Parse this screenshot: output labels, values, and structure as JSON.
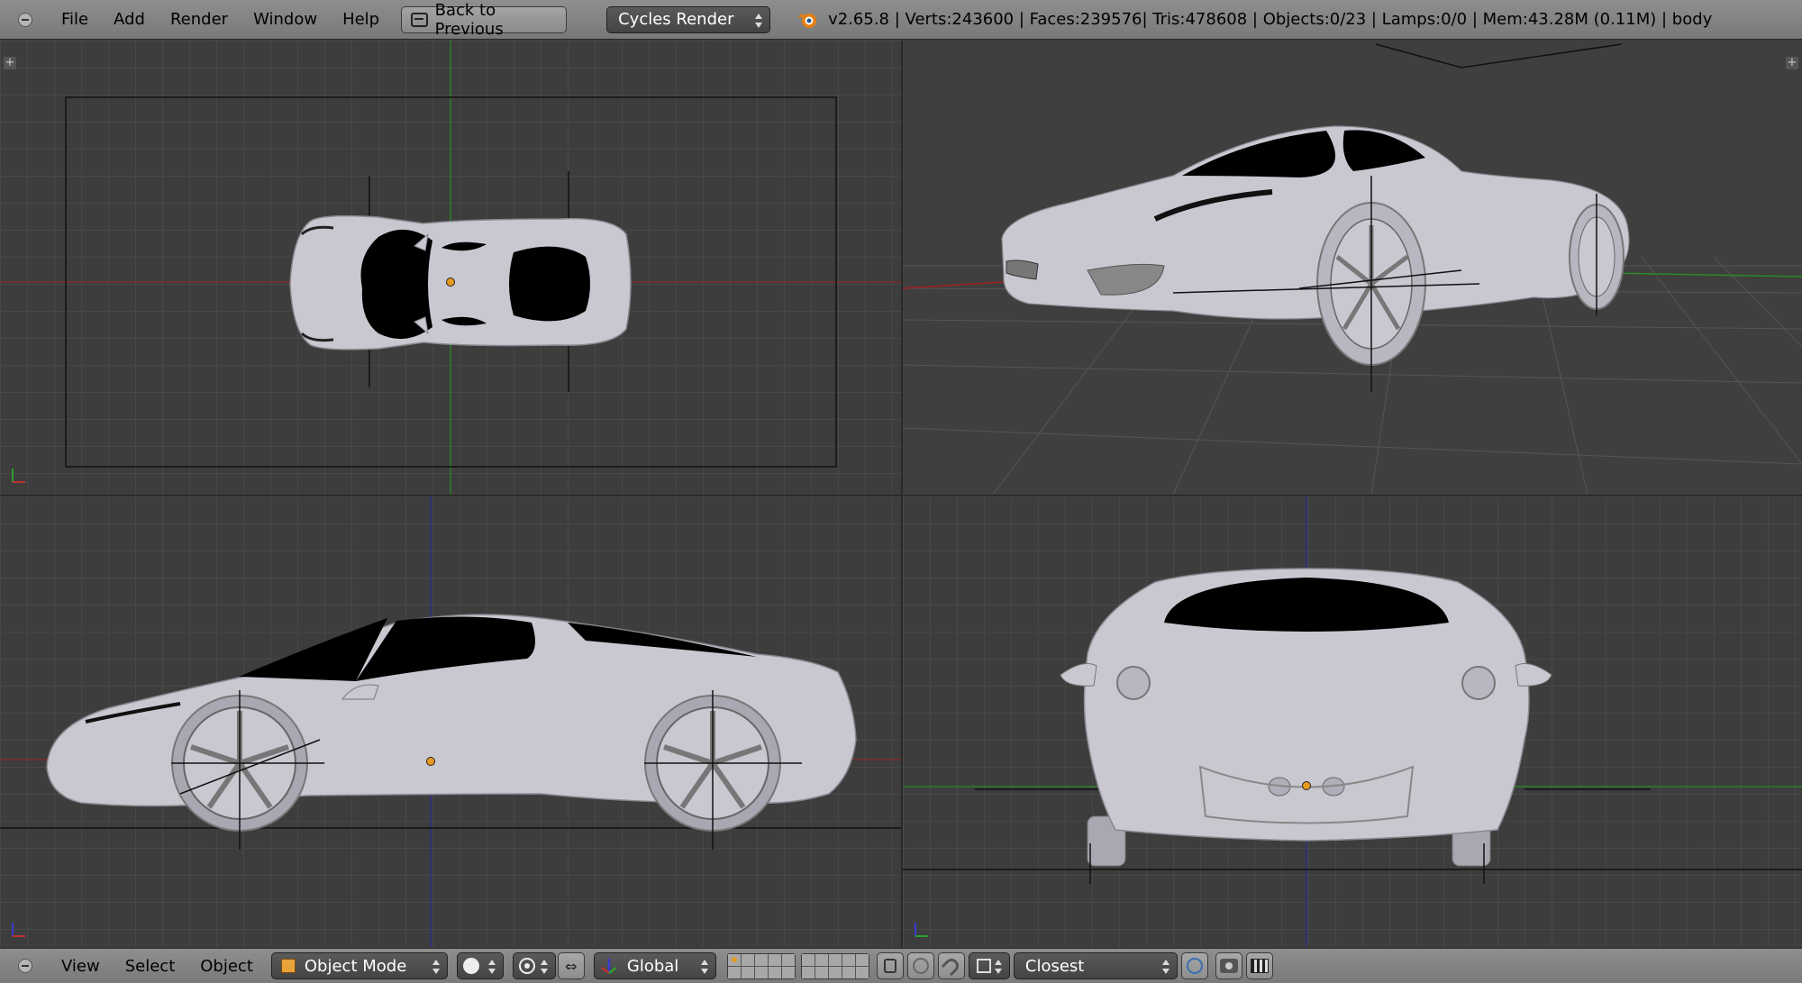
{
  "top_header": {
    "menus": [
      "File",
      "Add",
      "Render",
      "Window",
      "Help"
    ],
    "back_button_label": "Back to Previous",
    "render_engine": "Cycles Render",
    "stats": "v2.65.8 | Verts:243600 | Faces:239576| Tris:478608 | Objects:0/23 | Lamps:0/0 | Mem:43.28M (0.11M) | body"
  },
  "viewports": [
    {
      "name": "top-ortho",
      "view": "top"
    },
    {
      "name": "user-perspective",
      "view": "perspective"
    },
    {
      "name": "right-ortho",
      "view": "side"
    },
    {
      "name": "back-ortho",
      "view": "back"
    }
  ],
  "bottom_header": {
    "menus": [
      "View",
      "Select",
      "Object"
    ],
    "mode": "Object Mode",
    "transform_orientation": "Global",
    "snap_target": "Closest"
  },
  "colors": {
    "header": "#8a8a8a",
    "viewport_bg": "#3d3d3d",
    "grid": "#505050",
    "x_axis": "#a02020",
    "y_axis": "#2a8a2a",
    "z_axis": "#2a2aa0",
    "car_body": "#c9c7d0",
    "origin": "#e69a1e"
  },
  "icons": [
    "blender-logo-icon",
    "back-arrow-icon",
    "object-mode-cube-icon",
    "viewport-shading-icon",
    "pivot-icon",
    "manipulator-icon",
    "layers-icon",
    "lock-icon",
    "proportional-edit-icon",
    "snap-icon",
    "snap-element-icon",
    "render-camera-icon",
    "render-animation-icon"
  ]
}
